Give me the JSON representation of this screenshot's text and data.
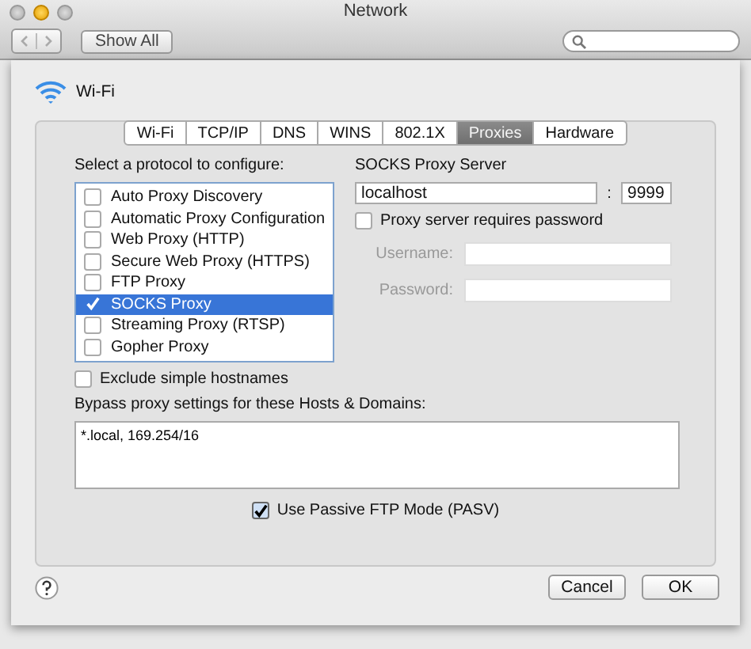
{
  "window": {
    "title": "Network"
  },
  "toolbar": {
    "show_all": "Show All"
  },
  "service": {
    "name": "Wi-Fi"
  },
  "tabs": [
    {
      "label": "Wi-Fi",
      "selected": false
    },
    {
      "label": "TCP/IP",
      "selected": false
    },
    {
      "label": "DNS",
      "selected": false
    },
    {
      "label": "WINS",
      "selected": false
    },
    {
      "label": "802.1X",
      "selected": false
    },
    {
      "label": "Proxies",
      "selected": true
    },
    {
      "label": "Hardware",
      "selected": false
    }
  ],
  "protocols": {
    "label": "Select a protocol to configure:",
    "items": [
      {
        "label": "Auto Proxy Discovery",
        "checked": false,
        "selected": false
      },
      {
        "label": "Automatic Proxy Configuration",
        "checked": false,
        "selected": false
      },
      {
        "label": "Web Proxy (HTTP)",
        "checked": false,
        "selected": false
      },
      {
        "label": "Secure Web Proxy (HTTPS)",
        "checked": false,
        "selected": false
      },
      {
        "label": "FTP Proxy",
        "checked": false,
        "selected": false
      },
      {
        "label": "SOCKS Proxy",
        "checked": true,
        "selected": true
      },
      {
        "label": "Streaming Proxy (RTSP)",
        "checked": false,
        "selected": false
      },
      {
        "label": "Gopher Proxy",
        "checked": false,
        "selected": false
      }
    ]
  },
  "server": {
    "label": "SOCKS Proxy Server",
    "host": "localhost",
    "separator": ":",
    "port": "9999",
    "requires_password": {
      "label": "Proxy server requires password",
      "checked": false
    },
    "username": {
      "label": "Username:",
      "disabled": true
    },
    "password": {
      "label": "Password:",
      "disabled": true
    }
  },
  "exclude_simple": {
    "label": "Exclude simple hostnames",
    "checked": false
  },
  "bypass": {
    "label": "Bypass proxy settings for these Hosts & Domains:",
    "value": "*.local, 169.254/16"
  },
  "passive_ftp": {
    "label": "Use Passive FTP Mode (PASV)",
    "checked": true
  },
  "buttons": [
    {
      "label": "Cancel"
    },
    {
      "label": "OK"
    }
  ]
}
